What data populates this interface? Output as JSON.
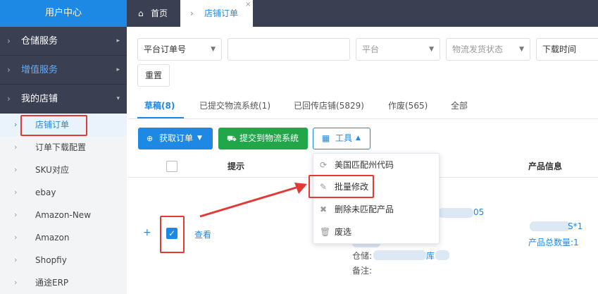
{
  "sidebar": {
    "header": "用户中心",
    "groups": [
      {
        "label": "仓储服务",
        "arrow": "▸"
      },
      {
        "label": "增值服务",
        "arrow": "▸"
      },
      {
        "label": "我的店铺",
        "arrow": "▾"
      }
    ],
    "subitems": [
      {
        "label": "店铺订单"
      },
      {
        "label": "订单下载配置"
      },
      {
        "label": "SKU对应"
      },
      {
        "label": "ebay"
      },
      {
        "label": "Amazon-New"
      },
      {
        "label": "Amazon"
      },
      {
        "label": "Shopfiy"
      },
      {
        "label": "通途ERP"
      }
    ]
  },
  "topbar": {
    "home_label": "首页",
    "active_tab_label": "店铺订单",
    "close_glyph": "×"
  },
  "filters": {
    "order_no_select": "平台订单号",
    "order_no_input": "",
    "platform_placeholder": "平台",
    "logistics_status_placeholder": "物流发货状态",
    "download_time_placeholder": "下载时间",
    "reset_label": "重置"
  },
  "status_tabs": [
    {
      "label": "草稿(8)"
    },
    {
      "label": "已提交物流系统(1)"
    },
    {
      "label": "已回传店铺(5829)"
    },
    {
      "label": "作废(565)"
    },
    {
      "label": "全部"
    }
  ],
  "actions": {
    "fetch_orders": "获取订单",
    "submit_logistics": "提交到物流系统",
    "tools": "工具",
    "colors": {
      "fetch": "#1e88e5",
      "submit": "#21a74a"
    }
  },
  "table": {
    "headers": {
      "hint": "提示",
      "product_info": "产品信息"
    },
    "row": {
      "expand": "+",
      "view": "查看",
      "order_partial": "05",
      "warehouse_label": "仓储:",
      "warehouse_suffix": "库",
      "remark_label": "备注:",
      "sku_suffix": "S*1",
      "product_total": "产品总数量:1"
    }
  },
  "tools_menu": [
    {
      "label": "美国匹配州代码",
      "icon": "refresh-icon"
    },
    {
      "label": "批量修改",
      "icon": "pencil-icon"
    },
    {
      "label": "删除未匹配产品",
      "icon": "close-icon"
    },
    {
      "label": "废选",
      "icon": "trash-icon"
    }
  ],
  "annotation_color": "#e53935"
}
